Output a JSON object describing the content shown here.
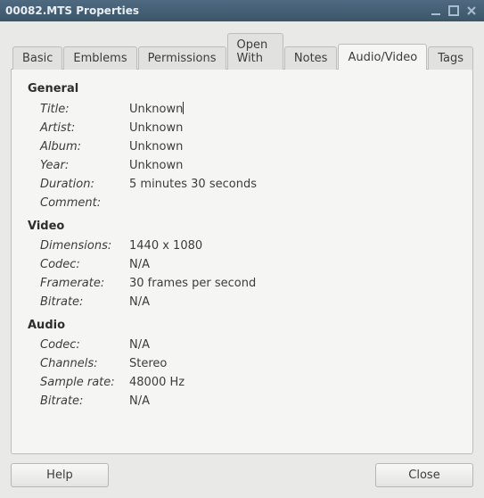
{
  "window": {
    "title": "00082.MTS Properties"
  },
  "tabs": {
    "basic": "Basic",
    "emblems": "Emblems",
    "permissions": "Permissions",
    "open_with": "Open With",
    "notes": "Notes",
    "audio_video": "Audio/Video",
    "tags": "Tags"
  },
  "sections": {
    "general": "General",
    "video": "Video",
    "audio": "Audio"
  },
  "labels": {
    "title": "Title:",
    "artist": "Artist:",
    "album": "Album:",
    "year": "Year:",
    "duration": "Duration:",
    "comment": "Comment:",
    "dimensions": "Dimensions:",
    "codec": "Codec:",
    "framerate": "Framerate:",
    "bitrate": "Bitrate:",
    "channels": "Channels:",
    "sample_rate": "Sample rate:"
  },
  "values": {
    "general": {
      "title": "Unknown",
      "artist": "Unknown",
      "album": "Unknown",
      "year": "Unknown",
      "duration": "5 minutes 30 seconds",
      "comment": ""
    },
    "video": {
      "dimensions": "1440 x 1080",
      "codec": "N/A",
      "framerate": "30 frames per second",
      "bitrate": "N/A"
    },
    "audio": {
      "codec": "N/A",
      "channels": "Stereo",
      "sample_rate": "48000 Hz",
      "bitrate": "N/A"
    }
  },
  "buttons": {
    "help": "Help",
    "close": "Close"
  }
}
